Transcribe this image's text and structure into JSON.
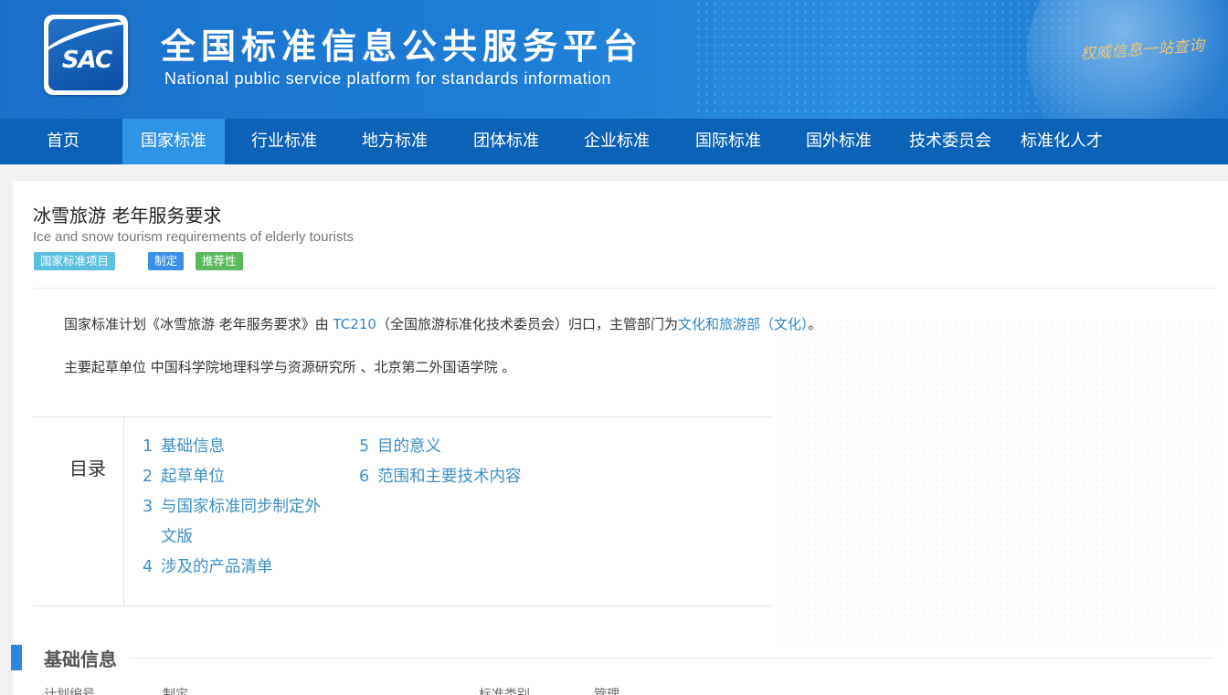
{
  "header": {
    "logo_text": "SAC",
    "title_cn": "全国标准信息公共服务平台",
    "title_en": "National public service platform  for standards information",
    "slogan": "权威信息一站查询"
  },
  "nav": {
    "items": [
      "首页",
      "国家标准",
      "行业标准",
      "地方标准",
      "团体标准",
      "企业标准",
      "国际标准",
      "国外标准",
      "技术委员会",
      "标准化人才"
    ],
    "active_index": 1
  },
  "standard": {
    "title": "冰雪旅游 老年服务要求",
    "title_en": "Ice and snow tourism requirements of elderly tourists",
    "tags": [
      {
        "label": "国家标准项目",
        "color": "#5bc0de"
      },
      {
        "label": "制定",
        "color": "#3a8ee6"
      },
      {
        "label": "推荐性",
        "color": "#5cb85c"
      }
    ],
    "para1_prefix": "国家标准计划《冰雪旅游 老年服务要求》由 ",
    "para1_tc_link": "TC210",
    "para1_middle": "（全国旅游标准化技术委员会）归口，主管部门为",
    "para1_dept_link": "文化和旅游部（文化）",
    "para1_suffix": "。",
    "para2": "主要起草单位 中国科学院地理科学与资源研究所 、北京第二外国语学院 。"
  },
  "toc": {
    "label": "目录",
    "items": [
      {
        "num": "1",
        "text": "基础信息"
      },
      {
        "num": "2",
        "text": "起草单位"
      },
      {
        "num": "3",
        "text": "与国家标准同步制定外"
      },
      {
        "num": "",
        "text": "文版"
      },
      {
        "num": "4",
        "text": "涉及的产品清单"
      },
      {
        "num": "5",
        "text": "目的意义"
      },
      {
        "num": "6",
        "text": "范围和主要技术内容"
      }
    ]
  },
  "section": {
    "title": "基础信息",
    "cut_row_left": "计划编号",
    "cut_row_left_value": "制定",
    "cut_row_right": "标准类别",
    "cut_row_right_value": "管理"
  },
  "colors": {
    "nav_bg": "#0b62b6",
    "nav_active": "#2f93e6",
    "link": "#2f86c8",
    "section_bar": "#2f86e0"
  }
}
